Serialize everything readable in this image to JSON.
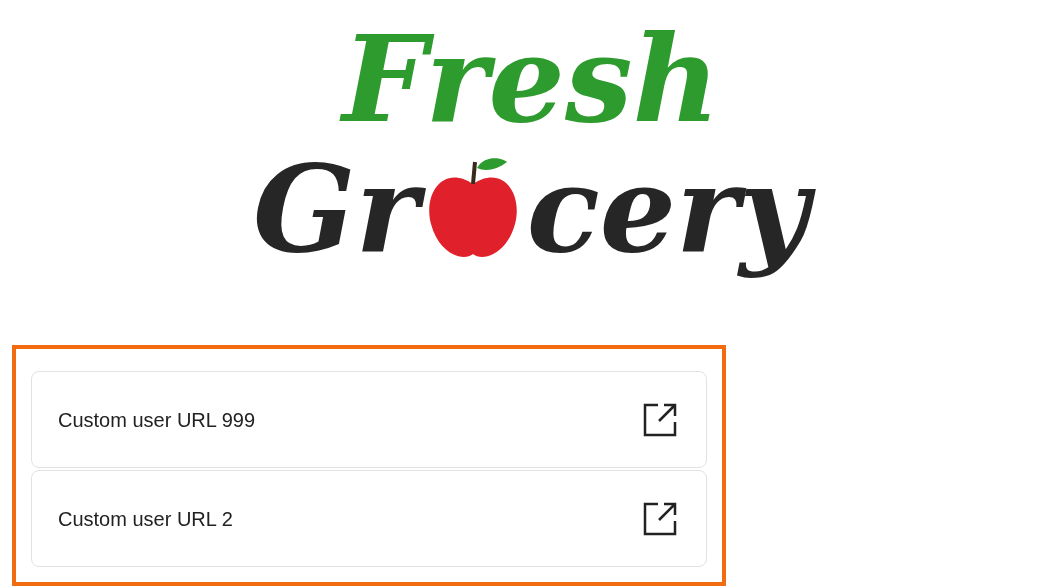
{
  "logo": {
    "top_word": "Fresh",
    "bottom_word_start": "Gr",
    "bottom_word_end": "cery"
  },
  "links": [
    {
      "label": "Custom user URL 999"
    },
    {
      "label": "Custom user URL 2"
    }
  ]
}
